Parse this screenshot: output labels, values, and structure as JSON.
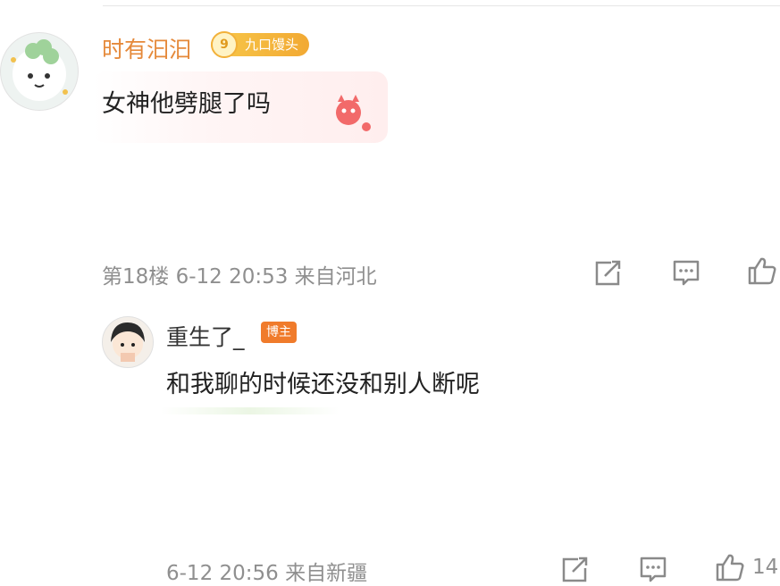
{
  "comment_1": {
    "username": "时有汩汩",
    "fan_badge": {
      "level": "9",
      "label": "九口馒头"
    },
    "text": "女神他劈腿了吗",
    "meta": "第18楼 6-12 20:53 来自河北"
  },
  "reply": {
    "username": "重生了_",
    "role_badge": "博主",
    "text": "和我聊的时候还没和别人断呢",
    "meta": "6-12 20:56 来自新疆",
    "like_count": "14"
  },
  "icons": [
    "share-icon",
    "comment-icon",
    "like-icon"
  ],
  "colors": {
    "username_orange": "#e5893a",
    "meta_gray": "#8f8f8f",
    "badge_orange": "#f07b2b"
  }
}
